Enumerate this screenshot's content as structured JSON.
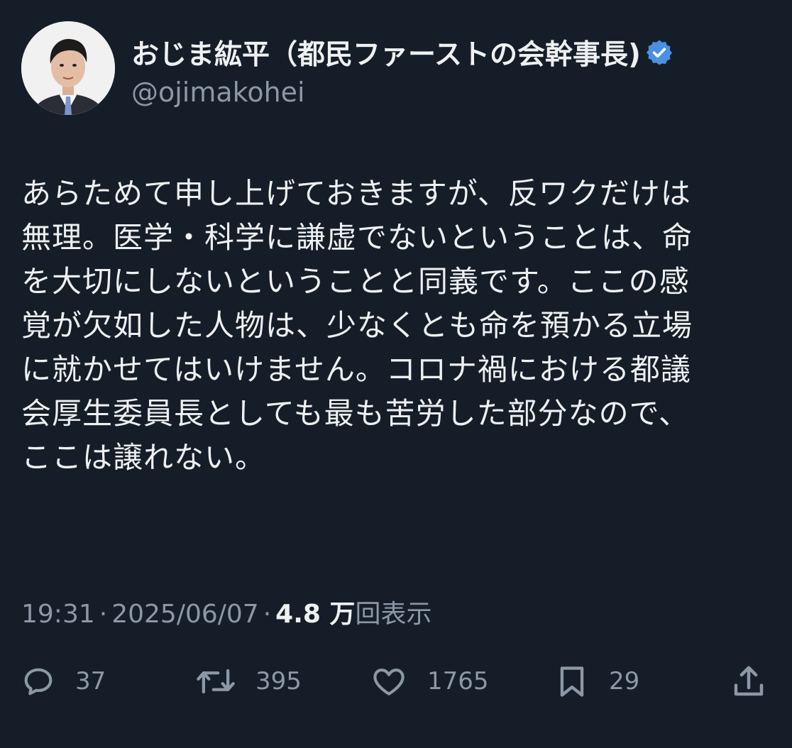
{
  "author": {
    "display_name": "おじま紘平（都民ファーストの会幹事長)",
    "handle": "@ojimakohei",
    "verified_color": "#4a90e2"
  },
  "tweet": {
    "lines": [
      "あらためて申し上げておきますが、反ワクだけは",
      "無理。医学・科学に謙虚でないということは、命",
      "を大切にしないということと同義です。ここの感",
      "覚が欠如した人物は、少なくとも命を預かる立場",
      "に就かせてはいけません。コロナ禍における都議",
      "会厚生委員長としても最も苦労した部分なので、",
      "ここは譲れない。"
    ]
  },
  "meta": {
    "time": "19:31",
    "separator": "·",
    "date": "2025/06/07",
    "views_count": "4.8 万",
    "views_label": "回表示"
  },
  "actions": {
    "reply": {
      "icon": "reply-icon",
      "count": "37"
    },
    "retweet": {
      "icon": "retweet-icon",
      "count": "395"
    },
    "like": {
      "icon": "heart-icon",
      "count": "1765"
    },
    "bookmark": {
      "icon": "bookmark-icon",
      "count": "29"
    },
    "share": {
      "icon": "share-icon"
    }
  }
}
